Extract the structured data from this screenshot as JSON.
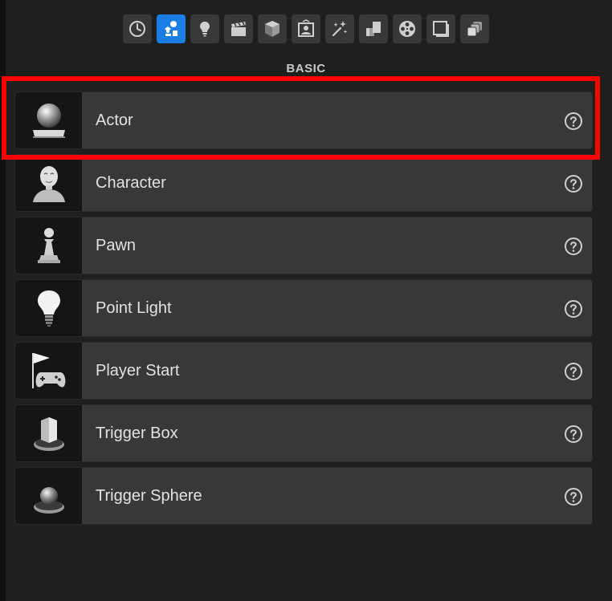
{
  "section": {
    "title": "BASIC"
  },
  "tabs": [
    {
      "icon": "recent-clock-icon",
      "active": false
    },
    {
      "icon": "basic-shapes-icon",
      "active": true
    },
    {
      "icon": "lightbulb-icon",
      "active": false
    },
    {
      "icon": "clapperboard-icon",
      "active": false
    },
    {
      "icon": "cube-icon",
      "active": false
    },
    {
      "icon": "portrait-frame-icon",
      "active": false
    },
    {
      "icon": "sparkles-icon",
      "active": false
    },
    {
      "icon": "stacked-blocks-icon",
      "active": false
    },
    {
      "icon": "film-reel-icon",
      "active": false
    },
    {
      "icon": "square-frame-icon",
      "active": false
    },
    {
      "icon": "layers-icon",
      "active": false
    }
  ],
  "items": [
    {
      "label": "Actor",
      "icon": "sphere-on-plinth-icon"
    },
    {
      "label": "Character",
      "icon": "bald-head-icon"
    },
    {
      "label": "Pawn",
      "icon": "chess-pawn-icon"
    },
    {
      "label": "Point Light",
      "icon": "light-bulb-icon"
    },
    {
      "label": "Player Start",
      "icon": "flag-gamepad-icon"
    },
    {
      "label": "Trigger Box",
      "icon": "box-on-disc-icon"
    },
    {
      "label": "Trigger Sphere",
      "icon": "sphere-on-disc-icon"
    }
  ],
  "colors": {
    "accent": "#1a7ee6",
    "highlight": "#ff0000"
  }
}
